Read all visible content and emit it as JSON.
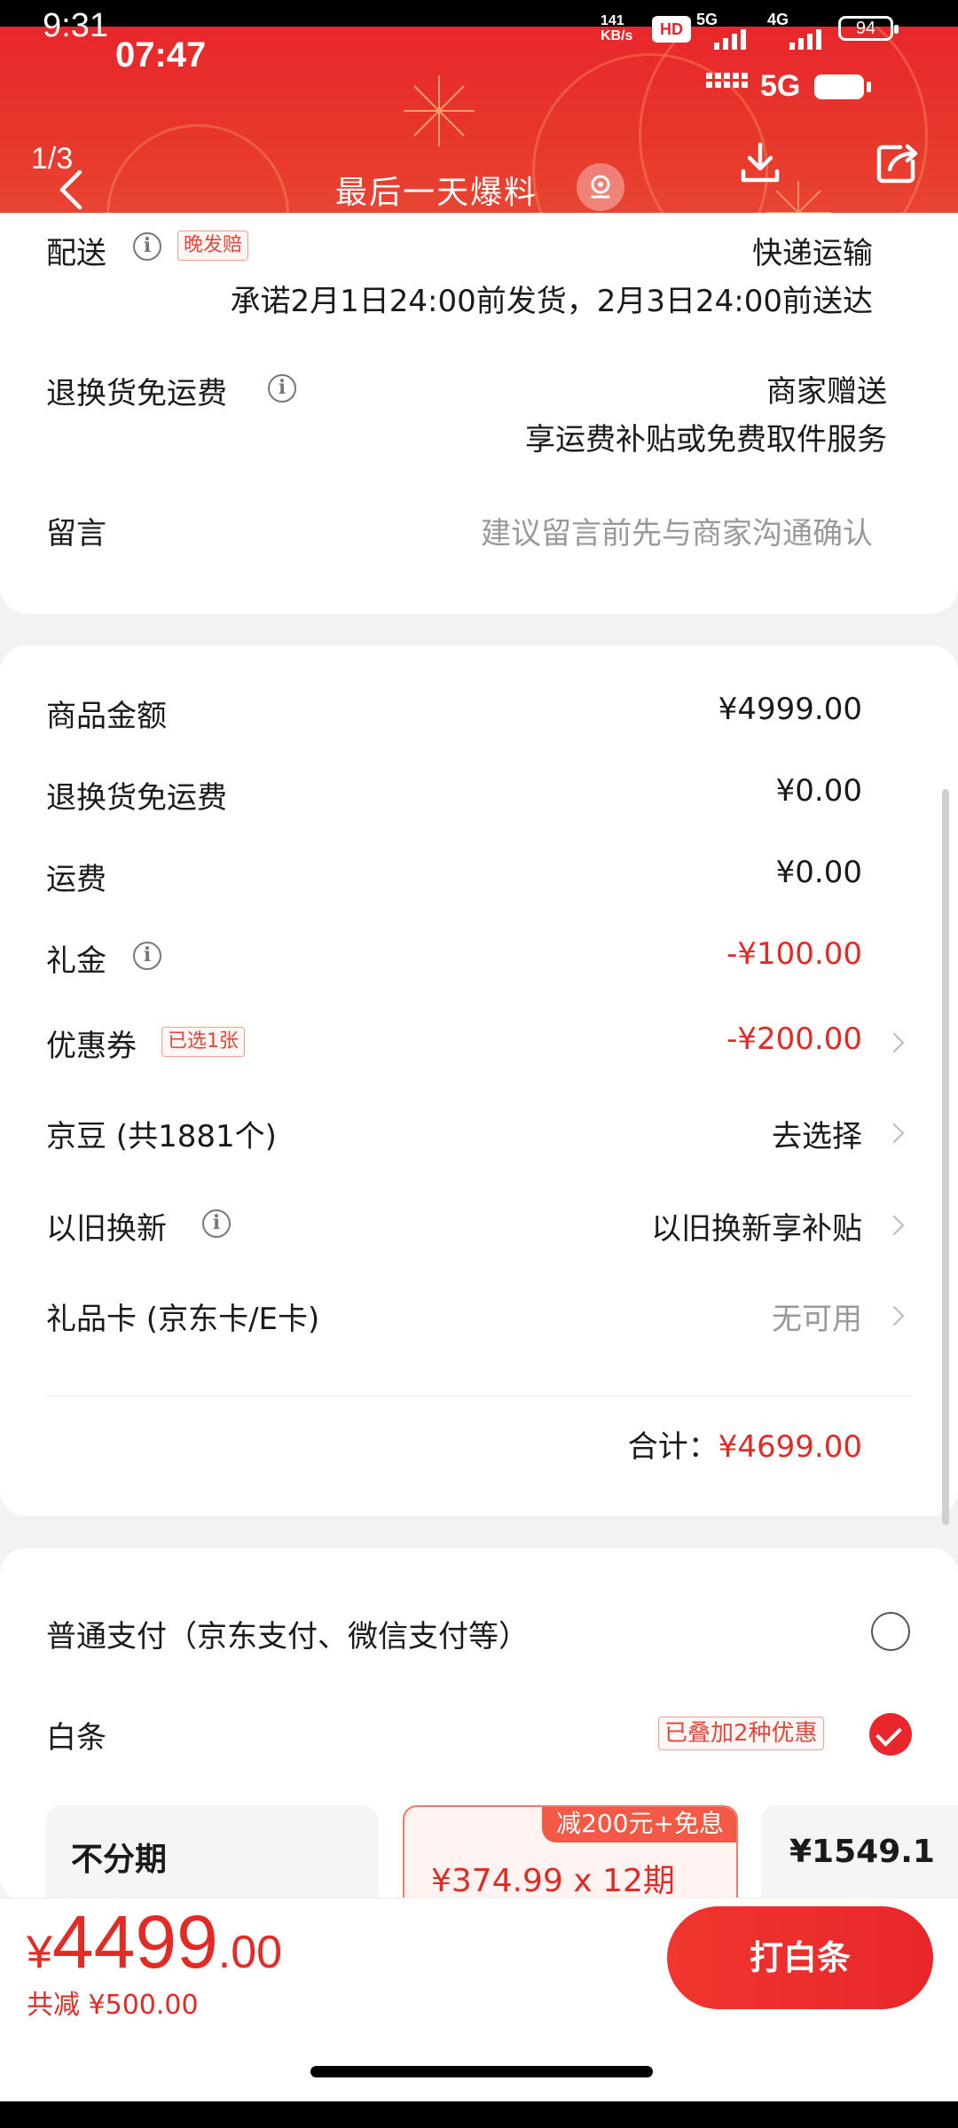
{
  "status_bar": {
    "time_outer": "9:31",
    "time_inner": "07:47",
    "net_speed_value": "141",
    "net_speed_unit": "KB/s",
    "hd_badge": "HD",
    "sim1_label": "5G",
    "sim2_label": "4G",
    "battery": "94",
    "inner_network": "5G"
  },
  "header": {
    "page_indicator": "1/3",
    "title": "最后一天爆料",
    "colors": {
      "header_red": "#e8262b"
    }
  },
  "delivery": {
    "label_partial": "配送",
    "tag_partial": "晚发赔",
    "value_partial": "快递运输",
    "promise": "承诺2月1日24:00前发货，2月3日24:00前送达"
  },
  "return_free_shipping": {
    "label": "退换货免运费",
    "value1": "商家赠送",
    "value2": "享运费补贴或免费取件服务"
  },
  "message": {
    "label": "留言",
    "placeholder": "建议留言前先与商家沟通确认"
  },
  "summary": {
    "rows": [
      {
        "label": "商品金额",
        "value": "¥4999.00"
      },
      {
        "label": "退换货免运费",
        "value": "¥0.00"
      },
      {
        "label": "运费",
        "value": "¥0.00"
      },
      {
        "label": "礼金",
        "value": "-¥100.00"
      },
      {
        "label": "优惠券",
        "tag": "已选1张",
        "value": "-¥200.00"
      },
      {
        "label": "京豆 (共1881个)",
        "value": "去选择"
      },
      {
        "label": "以旧换新",
        "value": "以旧换新享补贴"
      },
      {
        "label": "礼品卡 (京东卡/E卡)",
        "value": "无可用"
      }
    ],
    "total_label": "合计：",
    "total_value": "¥4699.00"
  },
  "payment": {
    "normal_label": "普通支付（京东支付、微信支付等）",
    "baitiao_label": "白条",
    "baitiao_tag": "已叠加2种优惠",
    "plans": [
      {
        "title": "不分期"
      },
      {
        "promo": "减200元+免息",
        "price": "¥374.99",
        "term": "x 12期"
      },
      {
        "price": "¥1549.1"
      }
    ]
  },
  "footer": {
    "currency": "¥",
    "price_int": "4499",
    "price_dec": ".00",
    "saved": "共减 ¥500.00",
    "pay_button": "打白条"
  }
}
